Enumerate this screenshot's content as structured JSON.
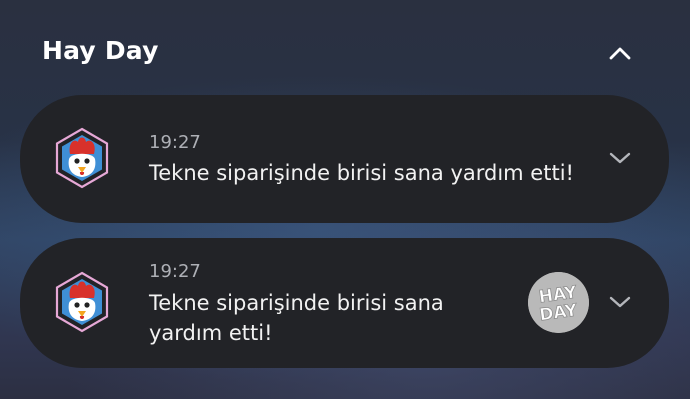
{
  "group": {
    "title": "Hay Day",
    "collapse_icon": "chevron-up-icon"
  },
  "notifications": [
    {
      "time": "19:27",
      "message": "Tekne siparişinde birisi sana yardım etti!",
      "app_icon": "hay-day-rooster-icon",
      "expand_icon": "chevron-down-icon"
    },
    {
      "time": "19:27",
      "message_line1": "Tekne siparişinde birisi sana",
      "message_line2": "yardım etti!",
      "app_icon": "hay-day-rooster-icon",
      "large_icon_text_1": "HAY",
      "large_icon_text_2": "DAY",
      "expand_icon": "chevron-down-icon"
    }
  ],
  "colors": {
    "card": "#222327",
    "time_text": "#aeb0b6",
    "icon_ring": "#e6a8d6"
  }
}
